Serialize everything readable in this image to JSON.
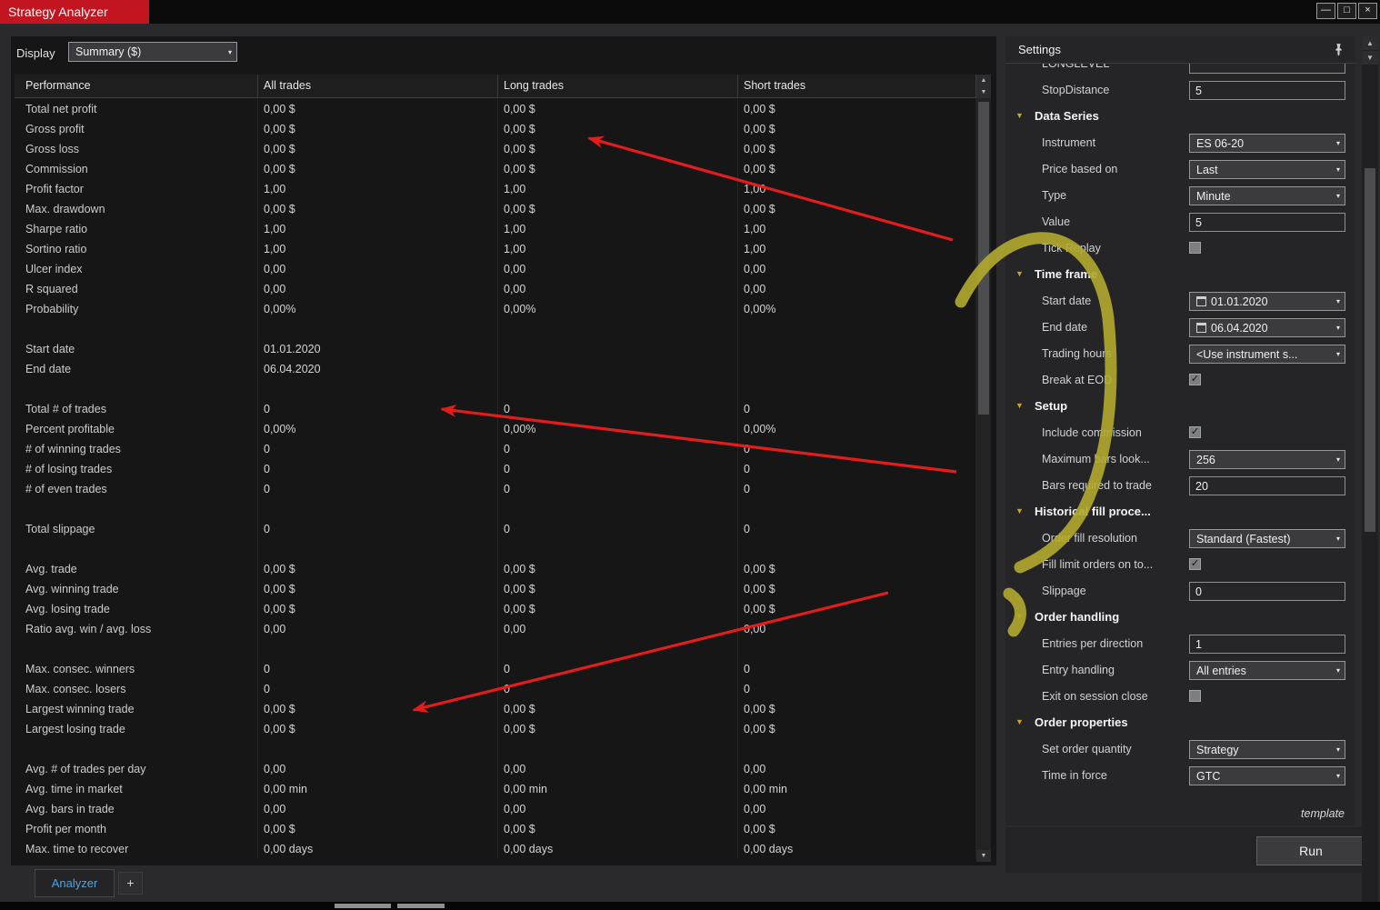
{
  "theme": {
    "title-red": "#c2151f",
    "tab-blue": "#4da3e8",
    "gold": "#c9a227",
    "ann-red": "#e51c1c",
    "ann-yellow": "#b2aa2e"
  },
  "icons": {
    "check": "✓",
    "chevron_down": "▾",
    "triangle_down": "▼",
    "up_arrow": "▲",
    "down_arrow": "▼",
    "minimize": "—",
    "maximize": "□",
    "close": "×"
  },
  "window": {
    "title": "Strategy Analyzer"
  },
  "toolbar": {
    "display_label": "Display",
    "display_value": "Summary ($)"
  },
  "table": {
    "columns": [
      "Performance",
      "All trades",
      "Long trades",
      "Short trades"
    ],
    "rows": [
      [
        "Total net profit",
        "0,00 $",
        "0,00 $",
        "0,00 $"
      ],
      [
        "Gross profit",
        "0,00 $",
        "0,00 $",
        "0,00 $"
      ],
      [
        "Gross loss",
        "0,00 $",
        "0,00 $",
        "0,00 $"
      ],
      [
        "Commission",
        "0,00 $",
        "0,00 $",
        "0,00 $"
      ],
      [
        "Profit factor",
        "1,00",
        "1,00",
        "1,00"
      ],
      [
        "Max. drawdown",
        "0,00 $",
        "0,00 $",
        "0,00 $"
      ],
      [
        "Sharpe ratio",
        "1,00",
        "1,00",
        "1,00"
      ],
      [
        "Sortino ratio",
        "1,00",
        "1,00",
        "1,00"
      ],
      [
        "Ulcer index",
        "0,00",
        "0,00",
        "0,00"
      ],
      [
        "R squared",
        "0,00",
        "0,00",
        "0,00"
      ],
      [
        "Probability",
        "0,00%",
        "0,00%",
        "0,00%"
      ],
      [
        "",
        "",
        "",
        ""
      ],
      [
        "Start date",
        "01.01.2020",
        "",
        ""
      ],
      [
        "End date",
        "06.04.2020",
        "",
        ""
      ],
      [
        "",
        "",
        "",
        ""
      ],
      [
        "Total # of trades",
        "0",
        "0",
        "0"
      ],
      [
        "Percent profitable",
        "0,00%",
        "0,00%",
        "0,00%"
      ],
      [
        "# of winning trades",
        "0",
        "0",
        "0"
      ],
      [
        "# of losing trades",
        "0",
        "0",
        "0"
      ],
      [
        "# of even trades",
        "0",
        "0",
        "0"
      ],
      [
        "",
        "",
        "",
        ""
      ],
      [
        "Total slippage",
        "0",
        "0",
        "0"
      ],
      [
        "",
        "",
        "",
        ""
      ],
      [
        "Avg. trade",
        "0,00 $",
        "0,00 $",
        "0,00 $"
      ],
      [
        "Avg. winning trade",
        "0,00 $",
        "0,00 $",
        "0,00 $"
      ],
      [
        "Avg. losing trade",
        "0,00 $",
        "0,00 $",
        "0,00 $"
      ],
      [
        "Ratio avg. win / avg. loss",
        "0,00",
        "0,00",
        "0,00"
      ],
      [
        "",
        "",
        "",
        ""
      ],
      [
        "Max. consec. winners",
        "0",
        "0",
        "0"
      ],
      [
        "Max. consec. losers",
        "0",
        "0",
        "0"
      ],
      [
        "Largest winning trade",
        "0,00 $",
        "0,00 $",
        "0,00 $"
      ],
      [
        "Largest losing trade",
        "0,00 $",
        "0,00 $",
        "0,00 $"
      ],
      [
        "",
        "",
        "",
        ""
      ],
      [
        "Avg. # of trades per day",
        "0,00",
        "0,00",
        "0,00"
      ],
      [
        "Avg. time in market",
        "0,00 min",
        "0,00 min",
        "0,00 min"
      ],
      [
        "Avg. bars in trade",
        "0,00",
        "0,00",
        "0,00"
      ],
      [
        "Profit per month",
        "0,00 $",
        "0,00 $",
        "0,00 $"
      ],
      [
        "Max. time to recover",
        "0,00 days",
        "0,00 days",
        "0,00 days"
      ]
    ]
  },
  "tabs": {
    "active_label": "Analyzer",
    "add_label": "+"
  },
  "settings": {
    "header": "Settings",
    "template_link": "template",
    "run_label": "Run",
    "rows": [
      {
        "type": "input",
        "cut": true,
        "label": "LONGLEVEL",
        "value": ""
      },
      {
        "type": "input",
        "label": "StopDistance",
        "value": "5"
      },
      {
        "type": "section",
        "label": "Data Series"
      },
      {
        "type": "select",
        "label": "Instrument",
        "value": "ES 06-20"
      },
      {
        "type": "select",
        "label": "Price based on",
        "value": "Last"
      },
      {
        "type": "select",
        "label": "Type",
        "value": "Minute"
      },
      {
        "type": "input",
        "label": "Value",
        "value": "5"
      },
      {
        "type": "checkbox",
        "label": "Tick Replay",
        "checked": false
      },
      {
        "type": "section",
        "label": "Time frame"
      },
      {
        "type": "date",
        "label": "Start date",
        "value": "01.01.2020"
      },
      {
        "type": "date",
        "label": "End date",
        "value": "06.04.2020"
      },
      {
        "type": "select",
        "label": "Trading hours",
        "value": "<Use instrument s..."
      },
      {
        "type": "checkbox",
        "label": "Break at EOD",
        "checked": true
      },
      {
        "type": "section",
        "label": "Setup"
      },
      {
        "type": "checkbox",
        "label": "Include commission",
        "checked": true
      },
      {
        "type": "select",
        "label": "Maximum bars look...",
        "value": "256"
      },
      {
        "type": "input",
        "label": "Bars required to trade",
        "value": "20"
      },
      {
        "type": "section",
        "label": "Historical fill proce..."
      },
      {
        "type": "select",
        "label": "Order fill resolution",
        "value": "Standard (Fastest)"
      },
      {
        "type": "checkbox",
        "label": "Fill limit orders on to...",
        "checked": true
      },
      {
        "type": "input",
        "label": "Slippage",
        "value": "0"
      },
      {
        "type": "section",
        "label": "Order handling"
      },
      {
        "type": "input",
        "label": "Entries per direction",
        "value": "1"
      },
      {
        "type": "select",
        "label": "Entry handling",
        "value": "All entries"
      },
      {
        "type": "checkbox",
        "label": "Exit on session close",
        "checked": false
      },
      {
        "type": "section",
        "label": "Order properties"
      },
      {
        "type": "select",
        "label": "Set order quantity",
        "value": "Strategy"
      },
      {
        "type": "select",
        "label": "Time in force",
        "value": "GTC"
      }
    ]
  }
}
